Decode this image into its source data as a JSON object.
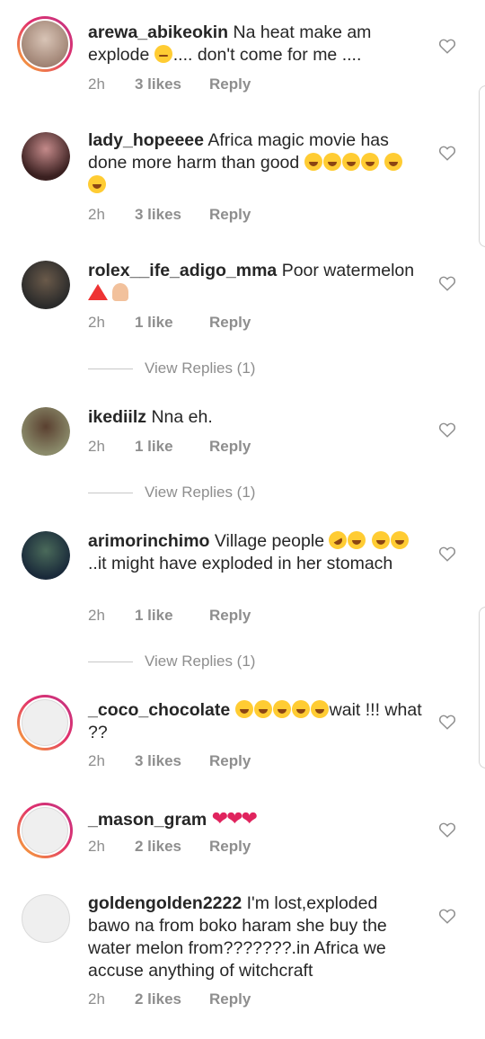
{
  "comments": [
    {
      "username": "arewa_abikeokin",
      "text": "Na heat make am explode",
      "text2": ".... don't come for me ....",
      "time": "2h",
      "likes": "3 likes",
      "reply": "Reply",
      "avatar_color": "#a68b7a",
      "story_ring": true
    },
    {
      "username": "lady_hopeeee",
      "text": "Africa magic movie has done more harm than good",
      "time": "2h",
      "likes": "3 likes",
      "reply": "Reply",
      "avatar_color": "#5a3a3a"
    },
    {
      "username": "rolex__ife_adigo_mma",
      "text": "Poor watermelon",
      "time": "2h",
      "likes": "1 like",
      "reply": "Reply",
      "view_replies": "View Replies (1)",
      "avatar_color": "#3a3a3a"
    },
    {
      "username": "ikediilz",
      "text": "Nna eh.",
      "time": "2h",
      "likes": "1 like",
      "reply": "Reply",
      "view_replies": "View Replies (1)",
      "avatar_color": "#7a6a4a"
    },
    {
      "username": "arimorinchimo",
      "text": "Village people",
      "text2": "..it might have exploded in her stomach",
      "time": "2h",
      "likes": "1 like",
      "reply": "Reply",
      "view_replies": "View Replies (1)",
      "avatar_color": "#2e4a3a"
    },
    {
      "username": "_coco_chocolate",
      "text": "wait !!! what ??",
      "time": "2h",
      "likes": "3 likes",
      "reply": "Reply",
      "story_ring": true
    },
    {
      "username": "_mason_gram",
      "text": "",
      "time": "2h",
      "likes": "2 likes",
      "reply": "Reply",
      "story_ring": true
    },
    {
      "username": "goldengolden2222",
      "text": "I'm lost,exploded bawo na from boko haram she buy the water melon from???????.in Africa we accuse anything of witchcraft",
      "time": "2h",
      "likes": "2 likes",
      "reply": "Reply"
    }
  ],
  "colors": {
    "secondary": "#8e8e8e",
    "text": "#262626",
    "heart": "#e0245e"
  }
}
